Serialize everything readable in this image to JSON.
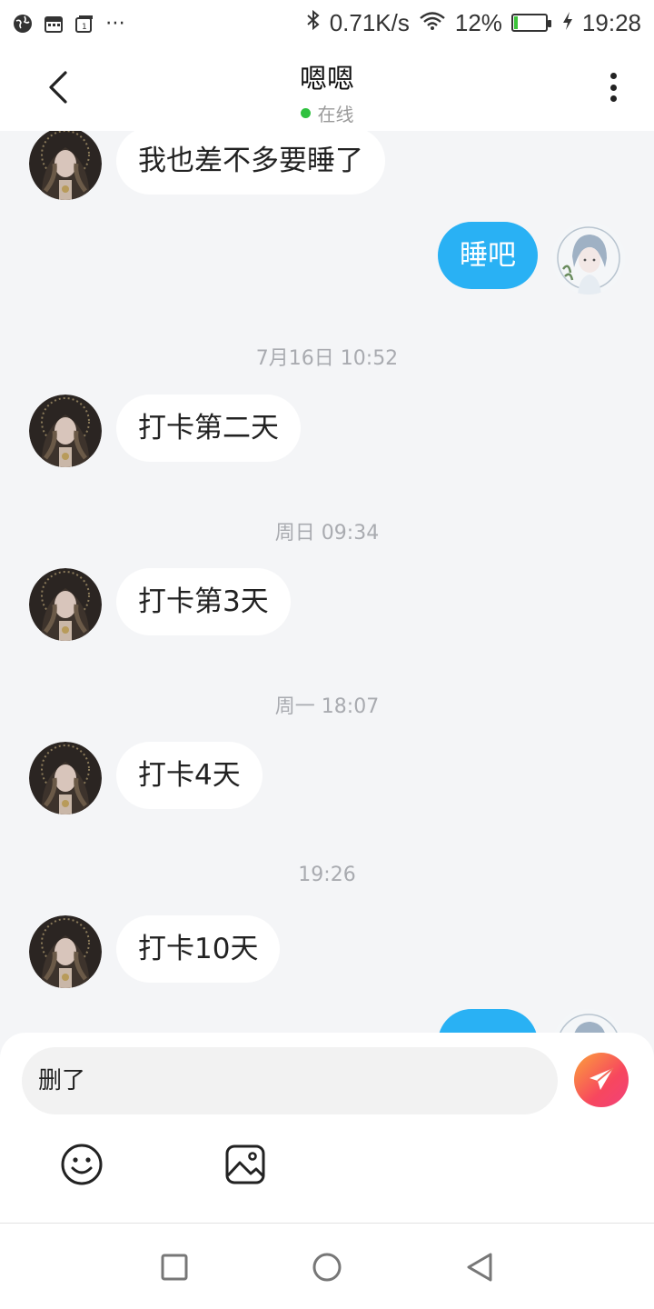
{
  "status_bar": {
    "net_speed": "0.71K/s",
    "battery_percent": "12%",
    "time": "19:28",
    "battery_level": 0.12,
    "icons": [
      "globe-icon",
      "calendar-icon",
      "calendar-icon",
      "more-icon",
      "bluetooth-icon",
      "wifi-icon",
      "battery-icon",
      "charging-icon"
    ]
  },
  "header": {
    "title": "嗯嗯",
    "status": "在线",
    "status_color": "#2fc13f"
  },
  "messages": [
    {
      "type": "in",
      "text": "我也差不多要睡了"
    },
    {
      "type": "out",
      "text": "睡吧"
    },
    {
      "type": "time",
      "text": "7月16日 10:52"
    },
    {
      "type": "in",
      "text": "打卡第二天"
    },
    {
      "type": "time",
      "text": "周日 09:34"
    },
    {
      "type": "in",
      "text": "打卡第3天"
    },
    {
      "type": "time",
      "text": "周一 18:07"
    },
    {
      "type": "in",
      "text": "打卡4天"
    },
    {
      "type": "time",
      "text": "19:26"
    },
    {
      "type": "in",
      "text": "打卡10天"
    },
    {
      "type": "out",
      "text": ""
    }
  ],
  "input": {
    "value": "删了"
  },
  "colors": {
    "accent_blue": "#29b1f4",
    "send_gradient": [
      "#fba23b",
      "#f1417a"
    ]
  }
}
